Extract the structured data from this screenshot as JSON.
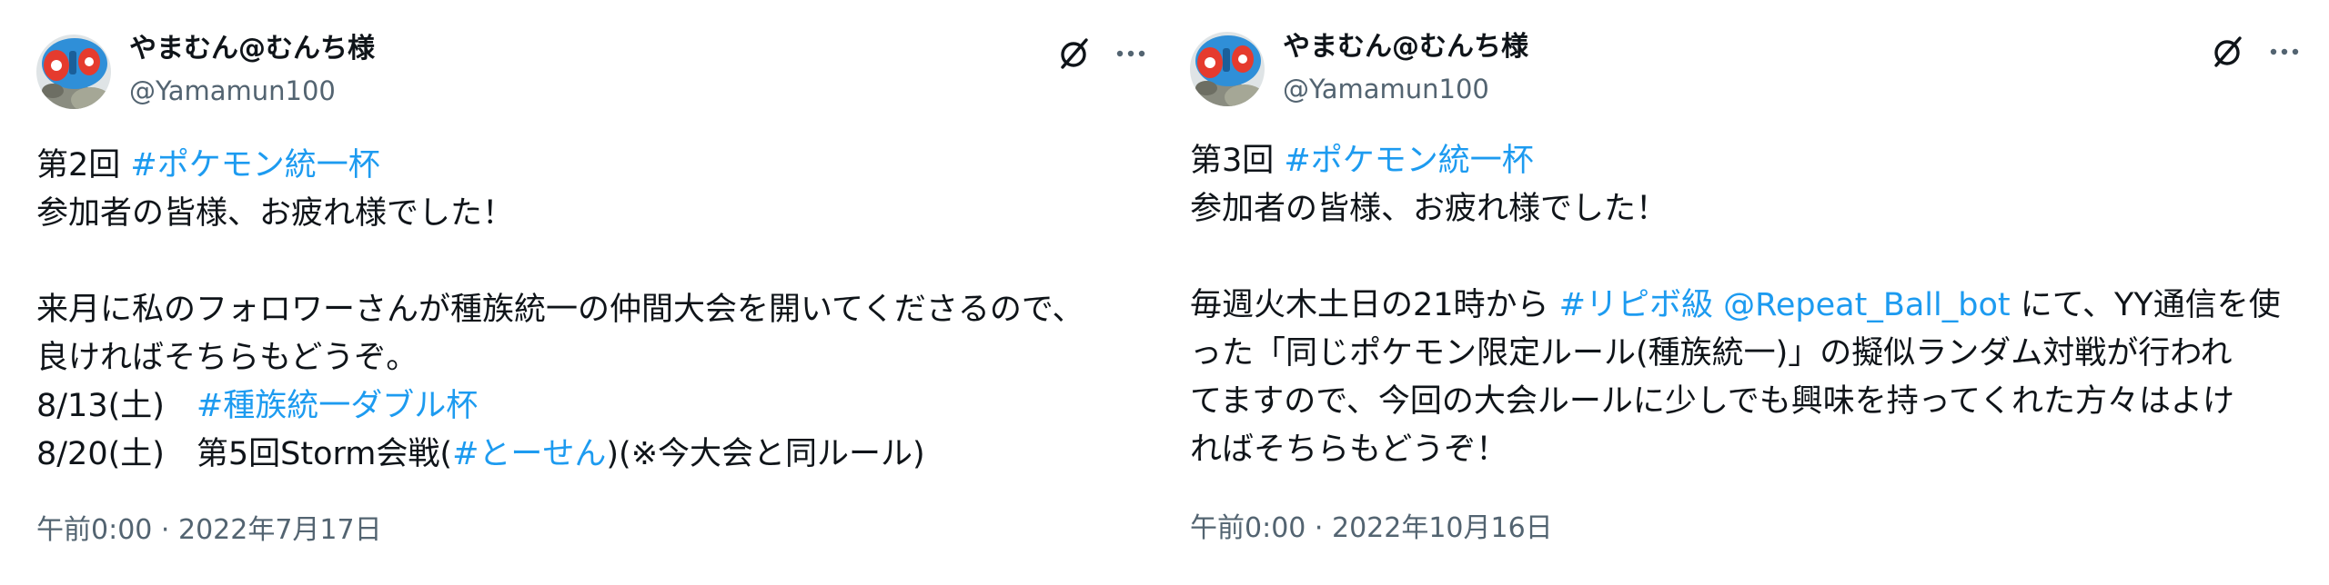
{
  "tweets": [
    {
      "author": {
        "display_name": "やまむん@むんち様",
        "handle": "@Yamamun100"
      },
      "icons": {
        "avatar": "avatar-image",
        "grok": "grok-icon",
        "more": "more-icon"
      },
      "lines": {
        "l1_prefix": "第2回 ",
        "l1_hashtag": "#ポケモン統一杯",
        "l2": "参加者の皆様、お疲れ様でした！",
        "l4": "来月に私のフォロワーさんが種族統一の仲間大会を開いてくださるので、",
        "l5": "良ければそちらもどうぞ。",
        "l6_date": "8/13(土)　",
        "l6_hashtag": "#種族統一ダブル杯",
        "l7_prefix": "8/20(土)　第5回Storm会戦(",
        "l7_hashtag": "#とーせん",
        "l7_suffix": ")(※今大会と同ルール)"
      },
      "timestamp": "午前0:00 · 2022年7月17日"
    },
    {
      "author": {
        "display_name": "やまむん@むんち様",
        "handle": "@Yamamun100"
      },
      "icons": {
        "avatar": "avatar-image",
        "grok": "grok-icon",
        "more": "more-icon"
      },
      "lines": {
        "l1_prefix": "第3回 ",
        "l1_hashtag": "#ポケモン統一杯",
        "l2": "参加者の皆様、お疲れ様でした！",
        "l4_prefix": "毎週火木土日の21時から ",
        "l4_hashtag": "#リピボ級",
        "l4_space": " ",
        "l4_mention": "@Repeat_Ball_bot",
        "l4_suffix": " にて、YY通信を使",
        "l5": "った「同じポケモン限定ルール(種族統一)」の擬似ランダム対戦が行われ",
        "l6": "てますので、今回の大会ルールに少しでも興味を持ってくれた方々はよけ",
        "l7": "ればそちらもどうぞ！"
      },
      "timestamp": "午前0:00 · 2022年10月16日"
    }
  ],
  "colors": {
    "text": "#0f1419",
    "secondary": "#536471",
    "link": "#1d9bf0"
  }
}
